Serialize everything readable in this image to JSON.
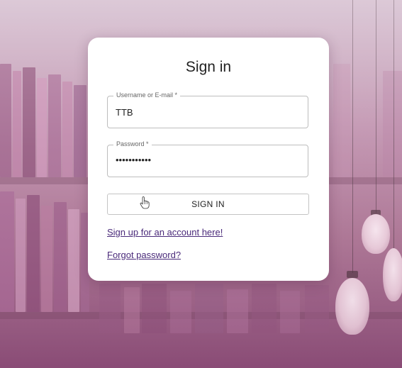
{
  "signin": {
    "title": "Sign in",
    "username": {
      "label": "Username or E-mail *",
      "value": "TTB"
    },
    "password": {
      "label": "Password *",
      "value": "•••••••••••"
    },
    "submit_label": "SIGN IN",
    "signup_link": "Sign up for an account here!",
    "forgot_link": "Forgot password?"
  },
  "icons": {
    "cursor": "hand-pointer-icon"
  },
  "colors": {
    "link": "#4a2a7a",
    "background_top": "#c9b4c4",
    "background_bottom": "#8c4f78"
  }
}
